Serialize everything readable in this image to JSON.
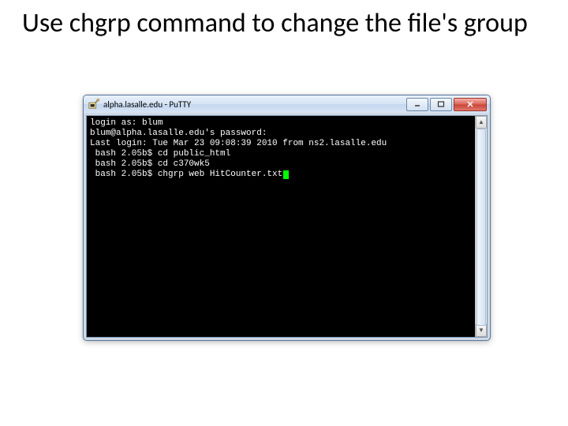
{
  "slide": {
    "title": "Use chgrp command to change the file's group"
  },
  "window": {
    "title": "alpha.lasalle.edu - PuTTY",
    "icon_name": "putty-icon",
    "buttons": {
      "minimize": "minimize",
      "maximize": "maximize",
      "close": "close"
    }
  },
  "terminal": {
    "lines": [
      "login as: blum",
      "blum@alpha.lasalle.edu's password:",
      "Last login: Tue Mar 23 09:08:39 2010 from ns2.lasalle.edu",
      " bash 2.05b$ cd public_html",
      " bash 2.05b$ cd c370wk5",
      " bash 2.05b$ chgrp web HitCounter.txt"
    ],
    "cursor_color": "#00ff00"
  }
}
